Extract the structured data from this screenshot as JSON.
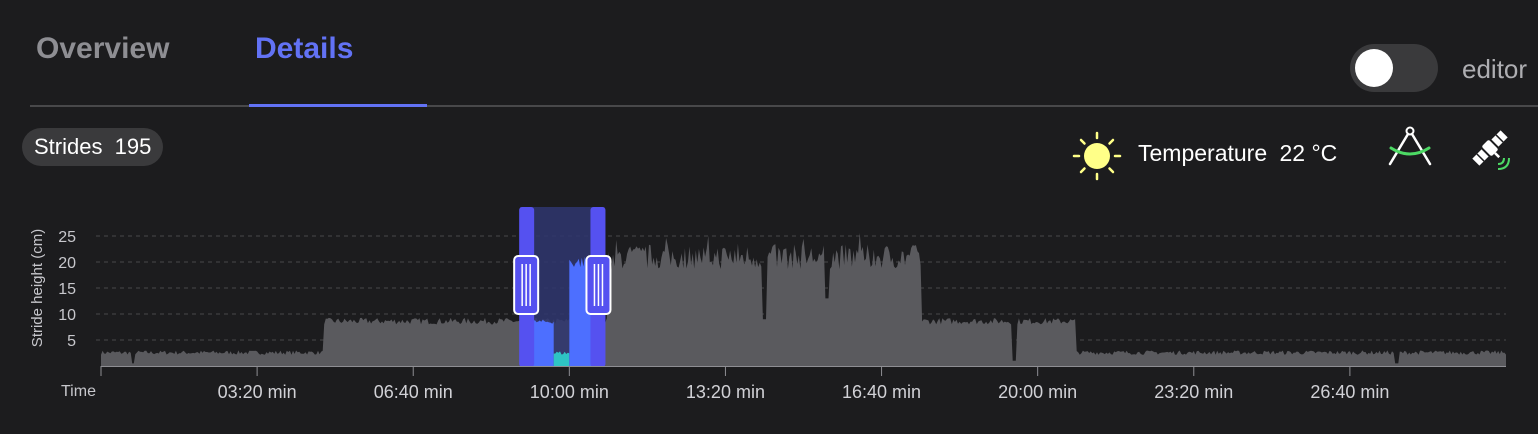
{
  "tabs": [
    {
      "label": "Overview",
      "active": false
    },
    {
      "label": "Details",
      "active": true
    }
  ],
  "editor": {
    "label": "editor",
    "enabled": false
  },
  "strides": {
    "label": "Strides",
    "count": "195"
  },
  "weather": {
    "label": "Temperature",
    "value": "22 °C",
    "icon": "sun-icon"
  },
  "tools": {
    "compass_icon": "compass-icon",
    "satellite_icon": "satellite-icon"
  },
  "colors": {
    "accent": "#6272f5",
    "selection": "#5551f0",
    "area": "#5a5a5e",
    "highlight_fill": "#4d6fff",
    "highlight_teal": "#2ec4c4",
    "sun": "#ffff88",
    "compass_green": "#4cd964"
  },
  "chart_data": {
    "type": "area",
    "xlabel": "Time",
    "ylabel": "Stride height (cm)",
    "ylim": [
      0,
      29
    ],
    "xlim": [
      0,
      1800
    ],
    "yticks": [
      5,
      10,
      15,
      20,
      25
    ],
    "xticks": [
      {
        "value": 200,
        "label": "03:20 min"
      },
      {
        "value": 400,
        "label": "06:40 min"
      },
      {
        "value": 600,
        "label": "10:00 min"
      },
      {
        "value": 800,
        "label": "13:20 min"
      },
      {
        "value": 1000,
        "label": "16:40 min"
      },
      {
        "value": 1200,
        "label": "20:00 min"
      },
      {
        "value": 1400,
        "label": "23:20 min"
      },
      {
        "value": 1600,
        "label": "26:40 min"
      }
    ],
    "grid": true,
    "selection": {
      "start": 537,
      "end": 645
    },
    "series": [
      {
        "segments": [
          {
            "from": 0,
            "to": 285,
            "level": 2.5
          },
          {
            "from": 285,
            "to": 650,
            "level": 8.5
          },
          {
            "from": 650,
            "to": 1052,
            "level": 20.5
          },
          {
            "from": 1052,
            "to": 1250,
            "level": 8.5
          },
          {
            "from": 1250,
            "to": 1800,
            "level": 2.5
          }
        ],
        "dips": [
          {
            "x": 41,
            "value": 0.5
          },
          {
            "x": 850,
            "value": 9
          },
          {
            "x": 930,
            "value": 13
          },
          {
            "x": 1170,
            "value": 1
          },
          {
            "x": 1660,
            "value": 0.5
          }
        ],
        "highlight": [
          {
            "from": 550,
            "to": 580,
            "level": 8.5
          },
          {
            "from": 580,
            "to": 600,
            "level": 2.5
          },
          {
            "from": 600,
            "to": 645,
            "level": 20
          }
        ]
      }
    ]
  }
}
